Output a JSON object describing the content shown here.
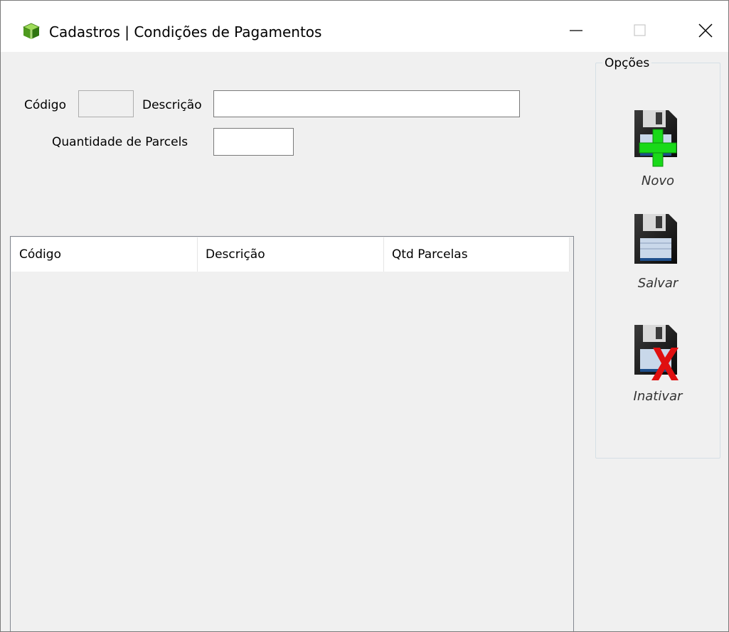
{
  "window": {
    "title": "Cadastros | Condições de Pagamentos"
  },
  "icons": {
    "app": "green-cube-icon",
    "minimize": "minimize-icon",
    "maximize": "maximize-icon",
    "close": "close-icon",
    "novo": "floppy-disk-plus-icon",
    "salvar": "floppy-disk-icon",
    "inativar": "floppy-disk-x-icon"
  },
  "form": {
    "codigo_label": "Código",
    "codigo_value": "",
    "descricao_label": "Descrição",
    "descricao_value": "",
    "parcelas_label": "Quantidade de Parcels",
    "parcelas_value": ""
  },
  "grid": {
    "columns": [
      "Código",
      "Descrição",
      "Qtd Parcelas"
    ],
    "rows": []
  },
  "options": {
    "legend": "Opções",
    "novo_label": "Novo",
    "salvar_label": "Salvar",
    "inativar_label": "Inativar"
  },
  "colors": {
    "accent_green": "#19d919",
    "accent_red": "#e01010",
    "disk_blue": "#1e4f8c"
  }
}
